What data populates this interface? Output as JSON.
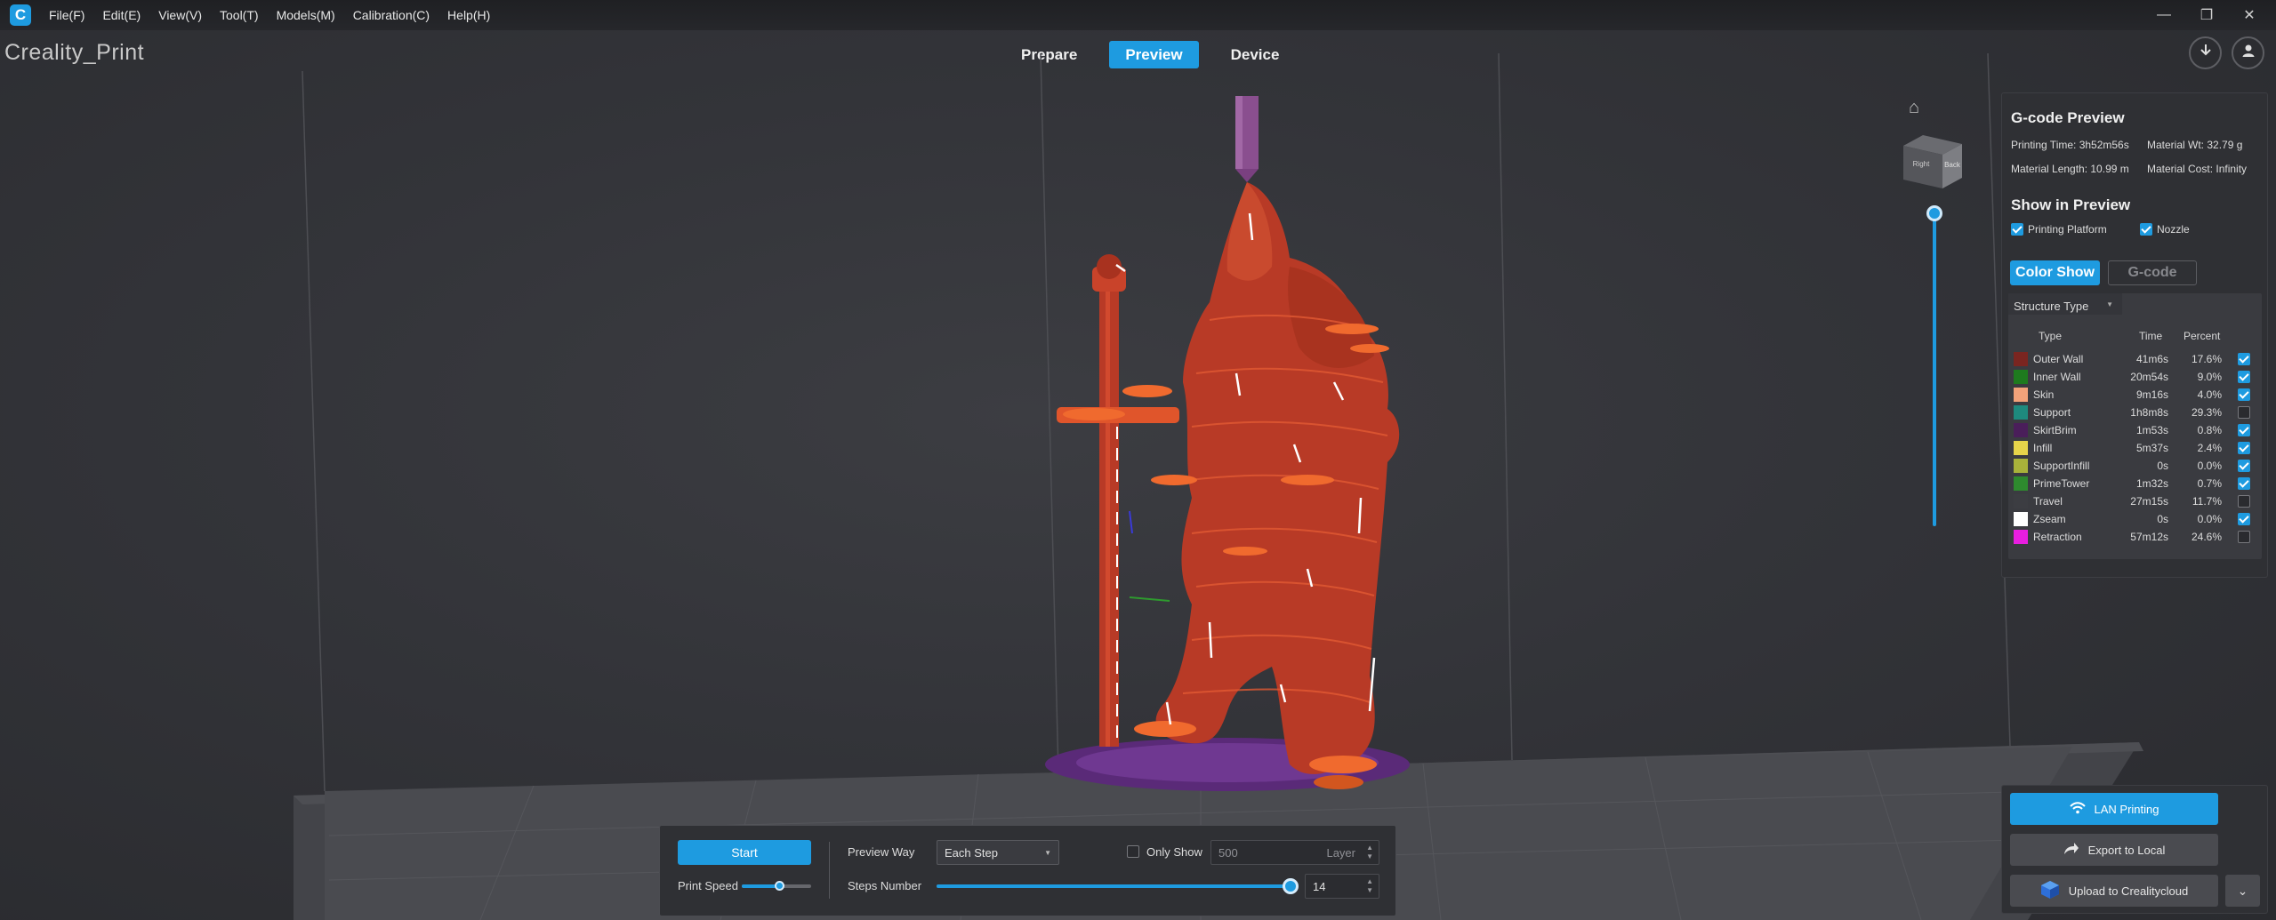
{
  "app": {
    "logo_glyph": "C",
    "title": "Creality_Print"
  },
  "menu": [
    "File(F)",
    "Edit(E)",
    "View(V)",
    "Tool(T)",
    "Models(M)",
    "Calibration(C)",
    "Help(H)"
  ],
  "window_controls": {
    "minimize": "—",
    "restore": "❐",
    "close": "✕"
  },
  "tabs": [
    {
      "label": "Prepare",
      "active": false
    },
    {
      "label": "Preview",
      "active": true
    },
    {
      "label": "Device",
      "active": false
    }
  ],
  "header_icons": [
    "download-icon",
    "user-icon"
  ],
  "view_cube": {
    "face_left": "Right",
    "face_front": "Back"
  },
  "gcode_preview": {
    "title": "G-code Preview",
    "printing_time": "Printing Time: 3h52m56s",
    "material_weight": "Material Wt: 32.79 g",
    "material_length": "Material Length: 10.99 m",
    "material_cost": "Material Cost: Infinity",
    "show_in_preview_title": "Show in Preview",
    "printing_platform": {
      "label": "Printing Platform",
      "checked": true
    },
    "nozzle": {
      "label": "Nozzle",
      "checked": true
    },
    "color_show_label": "Color Show",
    "gcode_label": "G-code",
    "structure_select": "Structure Type",
    "headers": {
      "type": "Type",
      "time": "Time",
      "percent": "Percent"
    },
    "rows": [
      {
        "type": "Outer Wall",
        "time": "41m6s",
        "percent": "17.6%",
        "color": "#7a2520",
        "checked": true
      },
      {
        "type": "Inner Wall",
        "time": "20m54s",
        "percent": "9.0%",
        "color": "#1e7a1e",
        "checked": true
      },
      {
        "type": "Skin",
        "time": "9m16s",
        "percent": "4.0%",
        "color": "#f2a27a",
        "checked": true
      },
      {
        "type": "Support",
        "time": "1h8m8s",
        "percent": "29.3%",
        "color": "#1e8a7e",
        "checked": false
      },
      {
        "type": "SkirtBrim",
        "time": "1m53s",
        "percent": "0.8%",
        "color": "#4a1e5a",
        "checked": true
      },
      {
        "type": "Infill",
        "time": "5m37s",
        "percent": "2.4%",
        "color": "#e6d44a",
        "checked": true
      },
      {
        "type": "SupportInfill",
        "time": "0s",
        "percent": "0.0%",
        "color": "#a8b23a",
        "checked": true
      },
      {
        "type": "PrimeTower",
        "time": "1m32s",
        "percent": "0.7%",
        "color": "#2e8a2e",
        "checked": true
      },
      {
        "type": "Travel",
        "time": "27m15s",
        "percent": "11.7%",
        "color": "#3c3d42",
        "checked": false
      },
      {
        "type": "Zseam",
        "time": "0s",
        "percent": "0.0%",
        "color": "#ffffff",
        "checked": true
      },
      {
        "type": "Retraction",
        "time": "57m12s",
        "percent": "24.6%",
        "color": "#e91ee0",
        "checked": false
      }
    ]
  },
  "device_panel": {
    "lan_printing": "LAN Printing",
    "export_local": "Export to Local",
    "upload_cloud": "Upload to Crealitycloud"
  },
  "controls": {
    "start_label": "Start",
    "print_speed_label": "Print Speed",
    "preview_way_label": "Preview Way",
    "preview_way_value": "Each Step",
    "only_show_label": "Only Show",
    "only_show_value": "500",
    "layer_label": "Layer",
    "steps_number_label": "Steps Number",
    "steps_number_value": "14",
    "print_speed_level": 0.55,
    "steps_level": 1.0
  },
  "colors": {
    "accent": "#1e9be0",
    "model": "#c0402a",
    "nozzle": "#8a4f8f"
  }
}
